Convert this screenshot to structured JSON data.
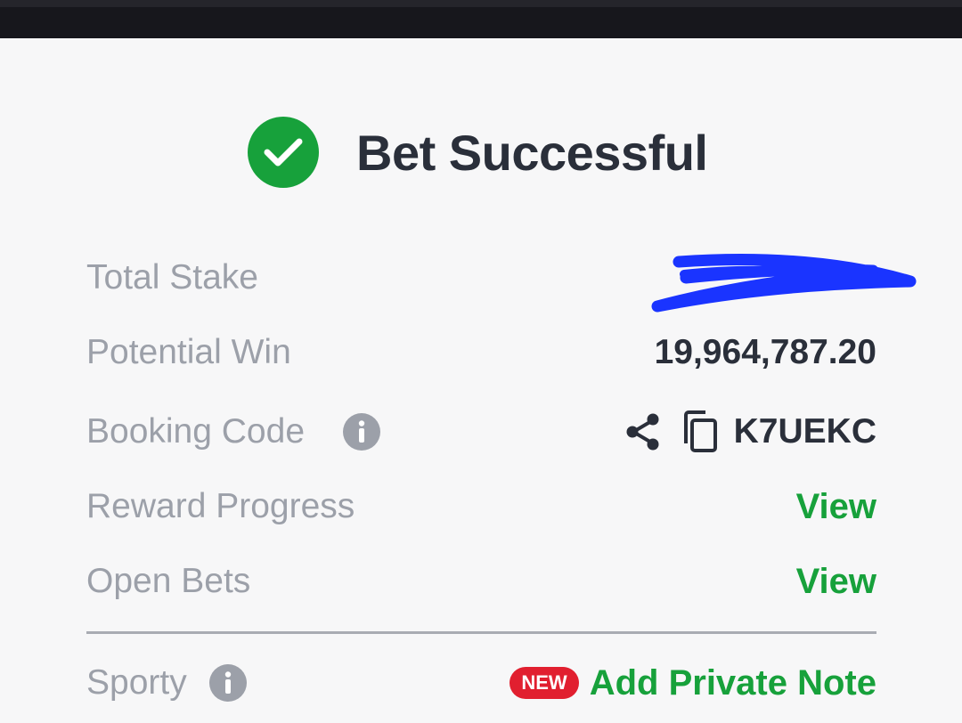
{
  "header": {
    "title": "Bet Successful"
  },
  "rows": {
    "total_stake": {
      "label": "Total Stake",
      "value": ""
    },
    "potential_win": {
      "label": "Potential Win",
      "value": "19,964,787.20"
    },
    "booking_code": {
      "label": "Booking Code",
      "value": "K7UEKC"
    },
    "reward_progress": {
      "label": "Reward Progress",
      "action": "View"
    },
    "open_bets": {
      "label": "Open Bets",
      "action": "View"
    },
    "sporty": {
      "label": "Sporty",
      "badge": "NEW",
      "action": "Add Private Note"
    }
  },
  "icons": {
    "success": "check-circle-icon",
    "info": "info-icon",
    "share": "share-icon",
    "copy": "copy-icon"
  },
  "colors": {
    "accent_green": "#17a13b",
    "badge_red": "#e11f2f",
    "label_gray": "#9ca0a9",
    "value_dark": "#2a2f3a",
    "redaction_blue": "#1a34ff"
  }
}
